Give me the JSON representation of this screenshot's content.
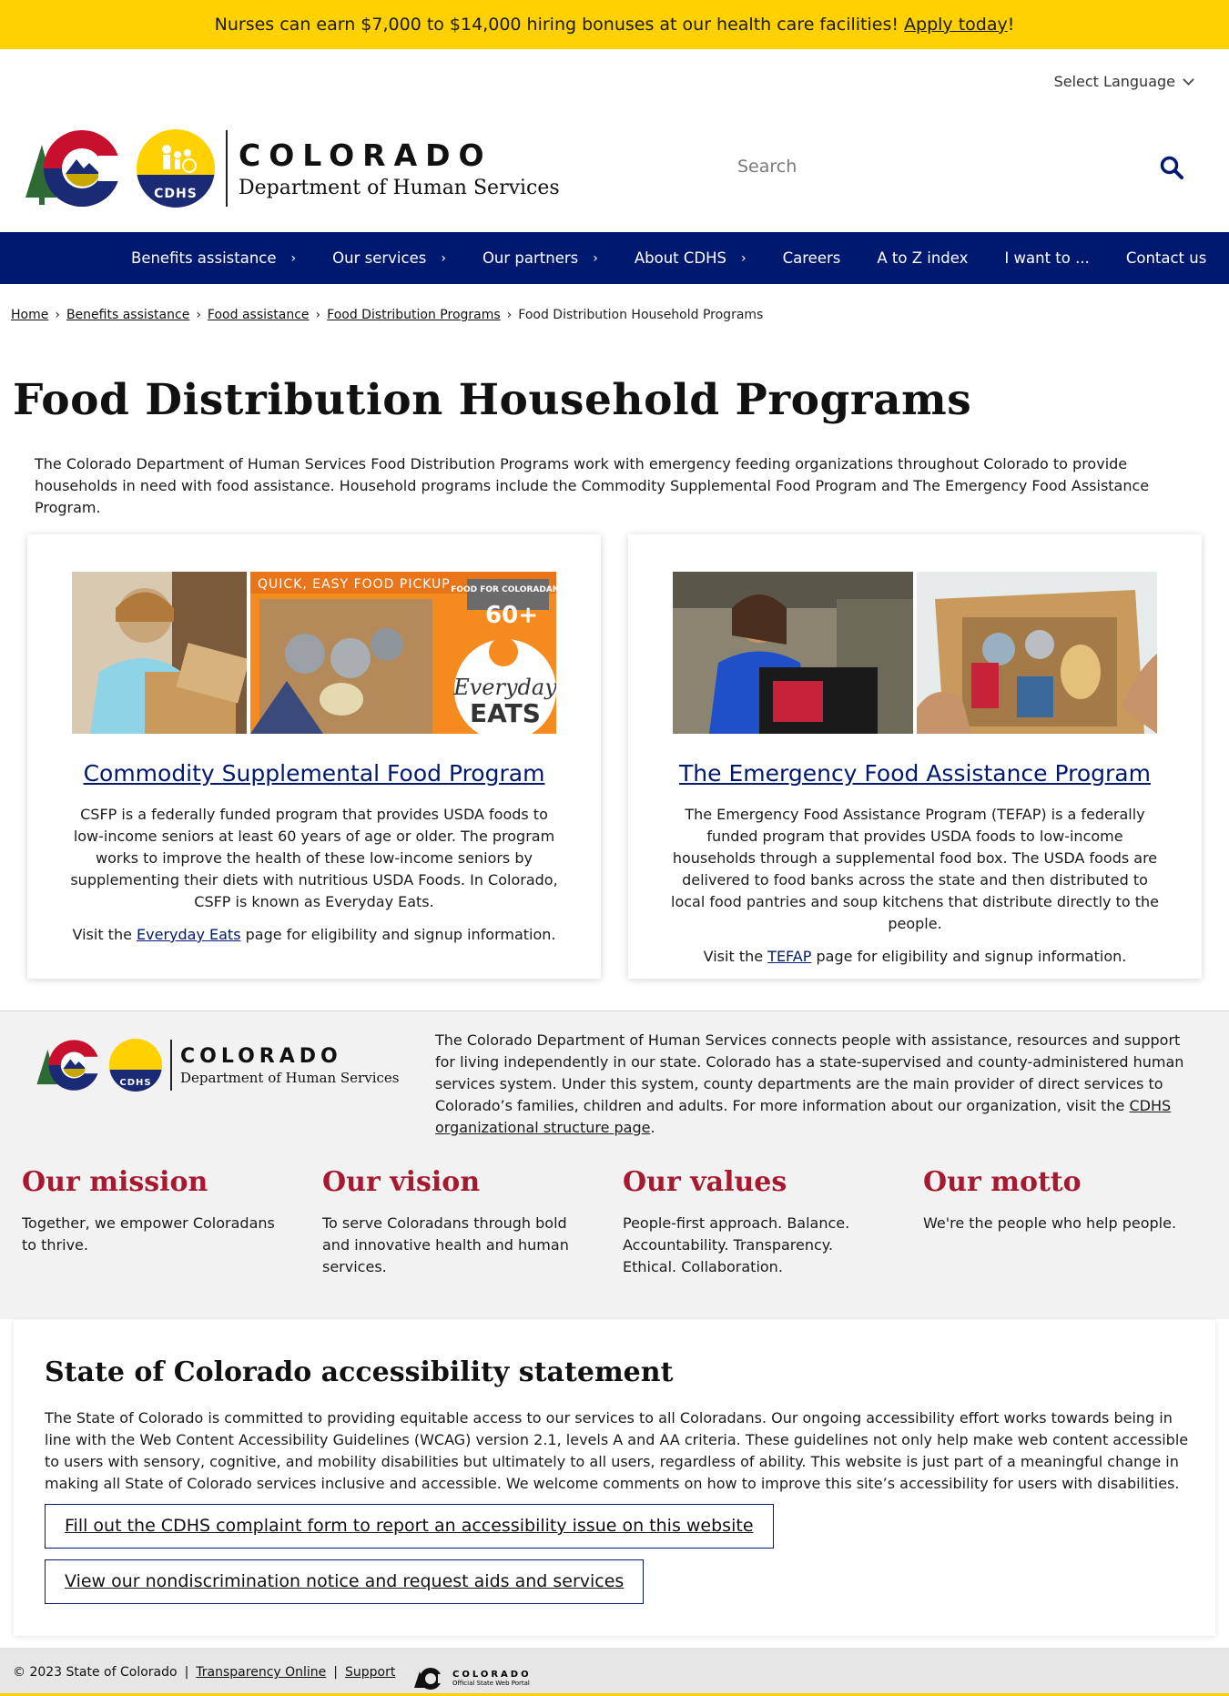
{
  "banner": {
    "text": "Nurses can earn $7,000 to $14,000 hiring bonuses at our health care facilities! ",
    "link": "Apply today",
    "tail": "!"
  },
  "language": {
    "label": "Select Language"
  },
  "header": {
    "logo_co": "COLORADO",
    "logo_dept": "Department of Human Services",
    "logo_badge": "CDHS"
  },
  "search": {
    "placeholder": "Search"
  },
  "nav": [
    {
      "label": "Benefits assistance",
      "has_arrow": true
    },
    {
      "label": "Our services",
      "has_arrow": true
    },
    {
      "label": "Our partners",
      "has_arrow": true
    },
    {
      "label": "About CDHS",
      "has_arrow": true
    },
    {
      "label": "Careers",
      "has_arrow": false
    },
    {
      "label": "A to Z index",
      "has_arrow": false
    },
    {
      "label": "I want to ...",
      "has_arrow": false
    },
    {
      "label": "Contact us",
      "has_arrow": false
    }
  ],
  "breadcrumb": {
    "items": [
      "Home",
      "Benefits assistance",
      "Food assistance",
      "Food Distribution Programs"
    ],
    "current": "Food Distribution Household Programs"
  },
  "page": {
    "title": "Food Distribution Household Programs",
    "intro": "The Colorado Department of Human Services Food Distribution Programs work with emergency feeding organizations throughout Colorado to provide households in need with food assistance. Household programs include the Commodity Supplemental Food Program and The Emergency Food Assistance Program."
  },
  "cards": [
    {
      "title": "Commodity Supplemental Food Program",
      "desc": "CSFP is a federally funded program that provides USDA foods to low-income seniors at least 60 years of age or older. The program works to improve the health of these low-income seniors by supplementing their diets with nutritious USDA Foods. In Colorado, CSFP is known as Everyday Eats.",
      "visit_pre": "Visit the ",
      "visit_link": "Everyday Eats",
      "visit_post": " page for eligibility and signup information.",
      "image_text": {
        "banner": "QUICK, EASY FOOD PICKUP",
        "tag": "FOOD FOR COLORADANS",
        "age": "60+",
        "brand1": "Everyday",
        "brand2": "EATS"
      }
    },
    {
      "title": "The Emergency Food Assistance Program",
      "desc": "The Emergency Food Assistance Program (TEFAP) is a federally funded program that provides USDA foods to low-income households through a supplemental food box. The USDA foods are delivered to food banks across the state and then distributed to local food pantries and soup kitchens that distribute directly to the people.",
      "visit_pre": "Visit the ",
      "visit_link": "TEFAP",
      "visit_post": " page for eligibility and signup information."
    }
  ],
  "about": {
    "text": "The Colorado Department of Human Services connects people with assistance, resources and support for living independently in our state. Colorado has a state-supervised and county-administered human services system. Under this system, county departments are the main provider of direct services to Colorado’s families, children and adults. For more information about our organization, visit the ",
    "link": "CDHS organizational structure page",
    "tail": ".",
    "columns": [
      {
        "title": "Our mission",
        "body": "Together, we empower Coloradans to thrive."
      },
      {
        "title": "Our vision",
        "body": "To serve Coloradans through bold and innovative health and human services."
      },
      {
        "title": "Our values",
        "body": "People-first approach. Balance. Accountability. Transparency. Ethical. Collaboration."
      },
      {
        "title": "Our motto",
        "body": "We're the people who help people."
      }
    ]
  },
  "accessibility": {
    "title": "State of Colorado accessibility statement",
    "body": "The State of Colorado is committed to providing equitable access to our services to all Coloradans. Our ongoing accessibility effort works towards being in line with the Web Content Accessibility Guidelines (WCAG) version 2.1, levels A and AA criteria. These guidelines not only help make web content accessible to users with sensory, cognitive, and mobility disabilities but ultimately to all users, regardless of ability. This website is just part of a meaningful change in making all State of Colorado services inclusive and accessible. We welcome comments on how to improve this site’s accessibility for users with disabilities.",
    "button1": "Fill out the CDHS complaint form to report an accessibility issue on this website",
    "button2": "View our nondiscrimination notice and request aids and services"
  },
  "footer": {
    "copyright": "© 2023 State of Colorado",
    "links": [
      "Transparency Online",
      "Support"
    ],
    "portal_co": "COLORADO",
    "portal_sub": "Official State Web Portal"
  },
  "colors": {
    "banner": "#ffd100",
    "nav": "#001970",
    "accent_red": "#a6192e",
    "link": "#001970"
  }
}
